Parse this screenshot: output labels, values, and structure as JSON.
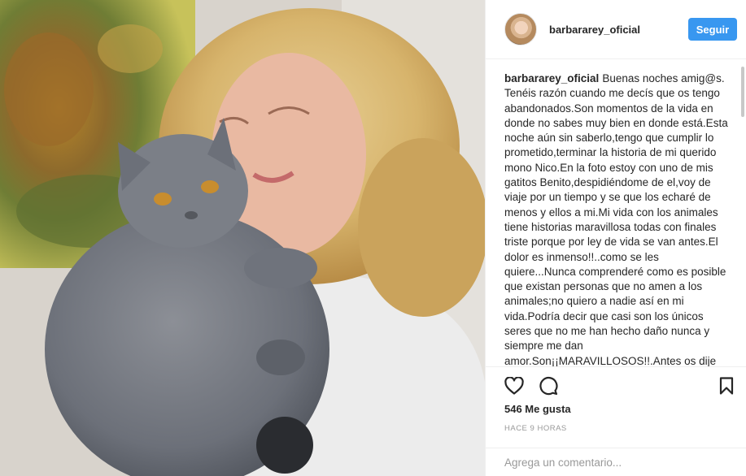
{
  "profile": {
    "username": "barbararey_oficial",
    "follow_label": "Seguir"
  },
  "caption": {
    "username": "barbararey_oficial",
    "text": "Buenas noches amig@s. Tenéis razón cuando me decís que os tengo abandonados.Son momentos de la vida en donde no sabes muy bien en donde está.Esta noche aún sin saberlo,tengo que cumplir lo prometido,terminar la historia de mi querido mono Nico.En la foto estoy con uno de mis gatitos Benito,despidiéndome de el,voy de viaje por un tiempo y se que los echaré de menos y ellos a mi.Mi vida con los animales tiene historias maravillosa todas con finales triste porque por ley de vida se van antes.El dolor es inmenso!!..como se les quiere...Nunca comprenderé como es posible que existan personas que no amen a los animales;no quiero a nadie así en mi vida.Podría decir que casi son los únicos seres que no me han hecho daño nunca y siempre me dan amor.Son¡¡MARAVILLOSOS!!.Antes os dije"
  },
  "engagement": {
    "likes": "546 Me gusta",
    "time": "HACE 9 HORAS"
  },
  "comment_box": {
    "placeholder": "Agrega un comentario..."
  },
  "icons": {
    "like": "heart-icon",
    "comment": "speech-bubble-icon",
    "save": "bookmark-icon"
  },
  "colors": {
    "follow_button": "#3897f0",
    "border": "#efefef",
    "muted_text": "#999999"
  }
}
